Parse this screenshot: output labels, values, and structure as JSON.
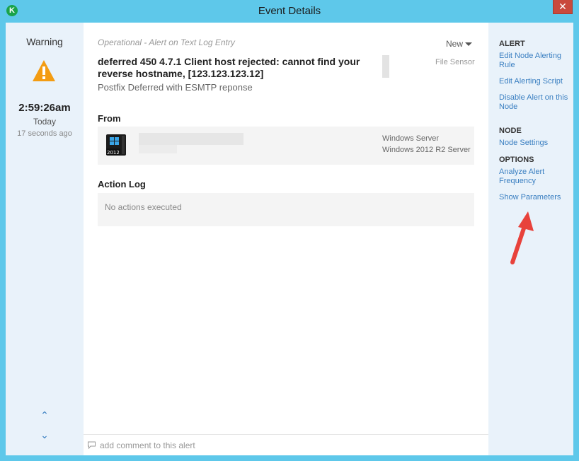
{
  "window": {
    "title": "Event Details",
    "close_glyph": "✕",
    "logo_glyph": "K"
  },
  "summary": {
    "severity": "Warning",
    "time": "2:59:26am",
    "day": "Today",
    "ago": "17 seconds ago",
    "nav_up_glyph": "⌃",
    "nav_down_glyph": "⌄"
  },
  "event": {
    "type": "Operational - Alert on Text Log Entry",
    "status": "New",
    "message": "deferred 450 4.7.1 Client host rejected: cannot find your reverse hostname, [123.123.123.12]",
    "sensor": "File Sensor",
    "subtitle": "Postfix Deferred with ESMTP reponse"
  },
  "from": {
    "heading": "From",
    "os_line1": "Windows Server",
    "os_line2": "Windows 2012 R2 Server",
    "icon_badge": "2012"
  },
  "action_log": {
    "heading": "Action Log",
    "empty_text": "No actions executed"
  },
  "comment": {
    "placeholder": "add comment to this alert"
  },
  "sidebar": {
    "alert_heading": "ALERT",
    "edit_rule": "Edit Node Alerting Rule",
    "edit_script": "Edit Alerting Script",
    "disable_alert": "Disable Alert on this Node",
    "node_heading": "NODE",
    "node_settings": "Node Settings",
    "options_heading": "OPTIONS",
    "analyze_frequency": "Analyze Alert Frequency",
    "show_parameters": "Show Parameters"
  },
  "colors": {
    "titlebar": "#5ec8ea",
    "warning": "#f39c12",
    "link": "#3a7fc1",
    "close": "#c9493c",
    "annotation_arrow": "#e8423b"
  }
}
